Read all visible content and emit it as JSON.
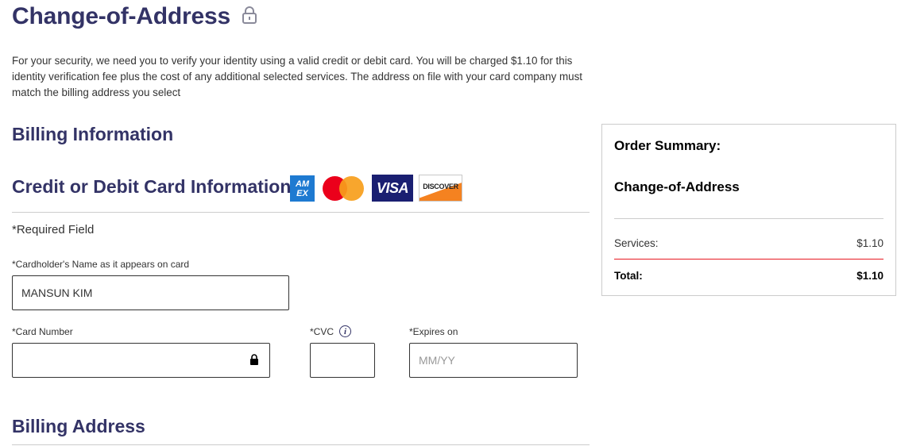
{
  "page": {
    "title": "Change-of-Address",
    "intro": "For your security, we need you to verify your identity using a valid credit or debit card. You will be charged $1.10 for this identity verification fee plus the cost of any additional selected services. The address on file with your card company must match the billing address you select"
  },
  "billing": {
    "heading": "Billing Information",
    "card_heading": "Credit or Debit Card Information",
    "card_logos": {
      "amex": "AM EX",
      "visa": "VISA",
      "discover": "DISCOVER"
    },
    "required_note": "*Required Field",
    "cardholder_label": "*Cardholder's Name as it appears on card",
    "cardholder_value": "MANSUN KIM",
    "card_number_label": "*Card Number",
    "card_number_value": "",
    "cvc_label": "*CVC",
    "cvc_value": "",
    "expires_label": "*Expires on",
    "expires_placeholder": "MM/YY",
    "address_heading": "Billing Address"
  },
  "summary": {
    "title": "Order Summary:",
    "item": "Change-of-Address",
    "services_label": "Services:",
    "services_value": "$1.10",
    "total_label": "Total:",
    "total_value": "$1.10"
  },
  "colors": {
    "heading": "#333366",
    "accent_rule": "#e71921",
    "amex": "#1e7ad1",
    "visa": "#1a1f71",
    "mc_red": "#eb001b",
    "mc_orange": "#f79e1b",
    "discover_orange": "#f58220"
  },
  "icons": [
    "lock-icon",
    "info-icon",
    "amex-logo",
    "mastercard-logo",
    "visa-logo",
    "discover-logo"
  ]
}
